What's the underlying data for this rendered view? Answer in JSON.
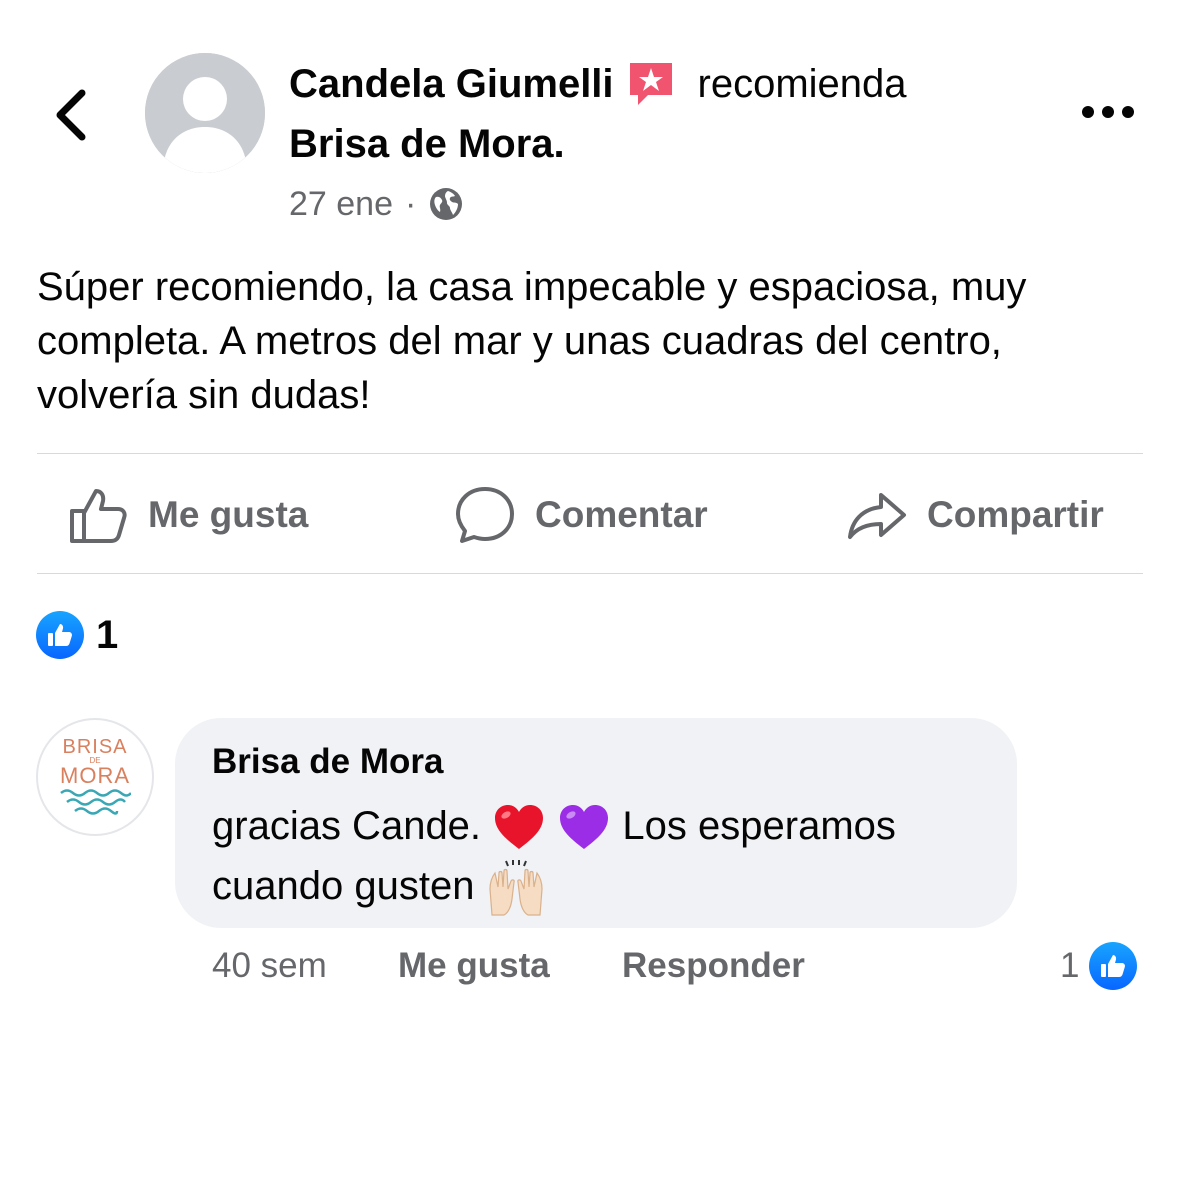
{
  "post": {
    "author_name": "Candela Giumelli",
    "recommend_word": "recomienda",
    "page_name": "Brisa de Mora.",
    "date": "27 ene",
    "separator": "·",
    "audience_icon": "globe-icon",
    "text": "Súper recomiendo, la casa impecable y espaciosa, muy completa. A metros del mar y unas cuadras del centro, volvería sin dudas!"
  },
  "actions": {
    "like_label": "Me gusta",
    "comment_label": "Comentar",
    "share_label": "Compartir"
  },
  "reactions": {
    "count": "1",
    "type": "like"
  },
  "comment": {
    "author_name": "Brisa de Mora",
    "logo_line1": "BRISA",
    "logo_line2": "DE",
    "logo_line3": "MORA",
    "text_part1": "gracias Cande.",
    "text_part2": "Los esperamos",
    "text_part3": "cuando gusten",
    "time": "40 sem",
    "like_label": "Me gusta",
    "reply_label": "Responder",
    "reaction_count": "1"
  },
  "colors": {
    "text_primary": "#050505",
    "text_secondary": "#65676b",
    "like_blue": "#0866ff",
    "bubble_bg": "#f0f2f5",
    "recommend_badge": "#f0546e",
    "logo_orange": "#d9805f",
    "logo_teal": "#3aa7b5"
  }
}
